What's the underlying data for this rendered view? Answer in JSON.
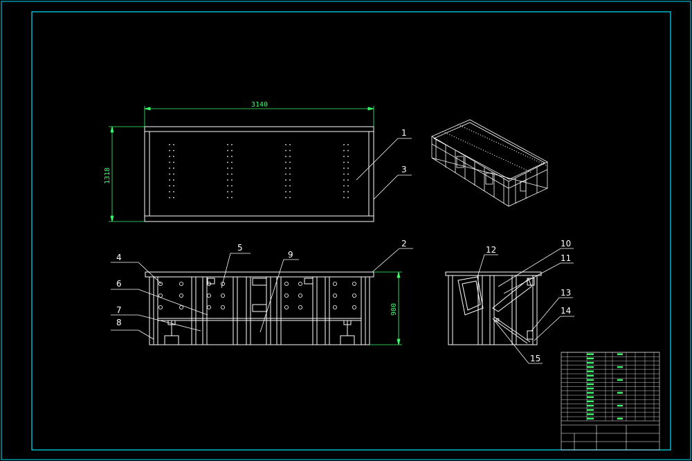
{
  "drawing": {
    "dimensions": {
      "top_width": "3140",
      "top_height": "1318",
      "front_height": "980"
    },
    "part_labels": [
      "1",
      "2",
      "3",
      "4",
      "5",
      "6",
      "7",
      "8",
      "9",
      "10",
      "11",
      "12",
      "13",
      "14",
      "15"
    ],
    "colors": {
      "background": "#000000",
      "border": "#00e5ff",
      "geometry": "#ffffff",
      "dimension": "#3bff6a",
      "leader": "#ffffff"
    }
  }
}
